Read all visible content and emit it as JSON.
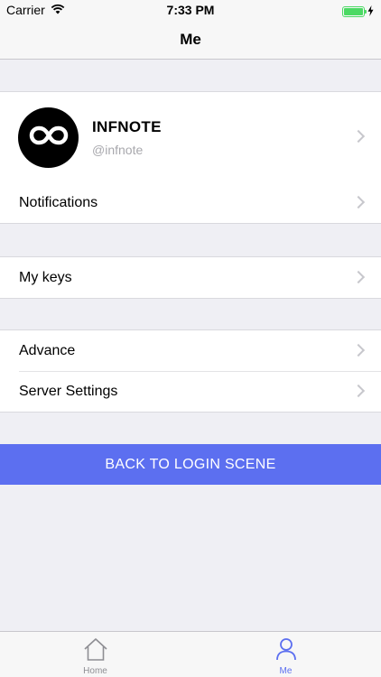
{
  "status_bar": {
    "carrier": "Carrier",
    "time": "7:33 PM",
    "battery_level_percent": 100
  },
  "nav": {
    "title": "Me"
  },
  "profile": {
    "name": "INFNOTE",
    "handle": "@infnote",
    "avatar_icon": "infinity-icon"
  },
  "sections": {
    "notifications": "Notifications",
    "my_keys": "My keys",
    "advance": "Advance",
    "server_settings": "Server Settings"
  },
  "action": {
    "label": "BACK TO LOGIN SCENE"
  },
  "tab_bar": {
    "home_label": "Home",
    "me_label": "Me",
    "active": "Me"
  },
  "colors": {
    "accent": "#5c6ff0",
    "background": "#efeff4",
    "battery": "#4cd964",
    "chevron": "#c7c7cc",
    "inactive_tab": "#8e8e93"
  }
}
